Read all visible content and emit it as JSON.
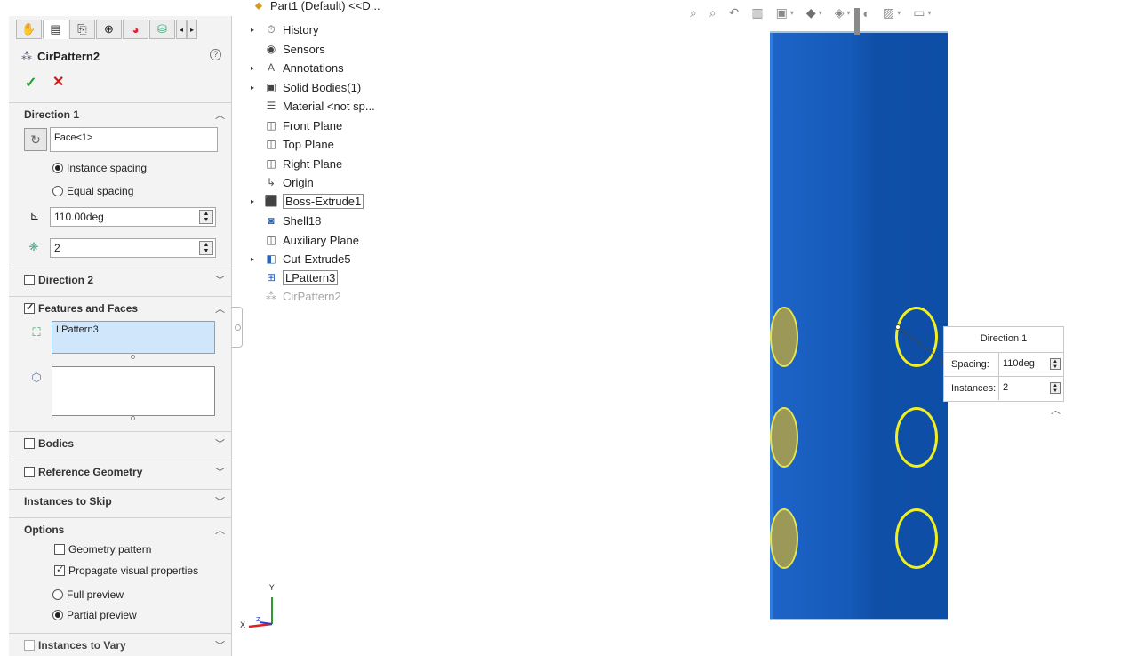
{
  "property_manager": {
    "tabs": [
      "feature-manager-icon",
      "property-manager-icon",
      "configuration-manager-icon",
      "dimxpert-icon",
      "display-manager-icon",
      "custom-icon"
    ],
    "title": "CirPattern2",
    "help_icon": "?",
    "ok_icon": "✓",
    "cancel_icon": "✕",
    "direction1": {
      "heading": "Direction 1",
      "axis_value": "Face<1>",
      "instance_spacing_label": "Instance spacing",
      "equal_spacing_label": "Equal spacing",
      "angle_value": "110.00deg",
      "instances_value": "2"
    },
    "direction2": {
      "heading": "Direction 2",
      "checked": false
    },
    "features_and_faces": {
      "heading": "Features and Faces",
      "checked": true,
      "features_value": "LPattern3",
      "faces_value": ""
    },
    "bodies": {
      "heading": "Bodies",
      "checked": false
    },
    "reference_geometry": {
      "heading": "Reference Geometry",
      "checked": false
    },
    "instances_to_skip": {
      "heading": "Instances to Skip"
    },
    "options": {
      "heading": "Options",
      "geometry_pattern_label": "Geometry pattern",
      "geometry_pattern_checked": false,
      "propagate_label": "Propagate visual properties",
      "propagate_checked": true,
      "full_preview_label": "Full preview",
      "partial_preview_label": "Partial preview",
      "selected_preview": "Partial preview"
    },
    "instances_to_vary": {
      "heading": "Instances to Vary",
      "checked": false
    }
  },
  "feature_tree": {
    "root": "Part1 (Default) <<D...",
    "items": [
      {
        "label": "History",
        "icon": "history-icon",
        "expandable": true
      },
      {
        "label": "Sensors",
        "icon": "sensors-icon",
        "expandable": false
      },
      {
        "label": "Annotations",
        "icon": "annotations-icon",
        "expandable": true
      },
      {
        "label": "Solid Bodies(1)",
        "icon": "solid-bodies-icon",
        "expandable": true
      },
      {
        "label": "Material <not sp...",
        "icon": "material-icon",
        "expandable": false
      },
      {
        "label": "Front Plane",
        "icon": "plane-icon",
        "expandable": false
      },
      {
        "label": "Top Plane",
        "icon": "plane-icon",
        "expandable": false
      },
      {
        "label": "Right Plane",
        "icon": "plane-icon",
        "expandable": false
      },
      {
        "label": "Origin",
        "icon": "origin-icon",
        "expandable": false
      },
      {
        "label": "Boss-Extrude1",
        "icon": "boss-extrude-icon",
        "expandable": true
      },
      {
        "label": "Shell18",
        "icon": "shell-icon",
        "expandable": false
      },
      {
        "label": "Auxiliary Plane",
        "icon": "plane-icon",
        "expandable": false
      },
      {
        "label": "Cut-Extrude5",
        "icon": "cut-extrude-icon",
        "expandable": true
      },
      {
        "label": "LPattern3",
        "icon": "linear-pattern-icon",
        "expandable": false
      },
      {
        "label": "CirPattern2",
        "icon": "circular-pattern-icon",
        "expandable": false
      }
    ]
  },
  "callout": {
    "title": "Direction 1",
    "spacing_label": "Spacing:",
    "spacing_value": "110deg",
    "instances_label": "Instances:",
    "instances_value": "2"
  },
  "triad": {
    "y_label": "Y",
    "x_label": "X",
    "z_label": "Z"
  },
  "colors": {
    "model_blue": "#155ab8",
    "highlight_yellow": "#f1ef20",
    "ok_green": "#1e9e2f",
    "cancel_red": "#d21919"
  }
}
